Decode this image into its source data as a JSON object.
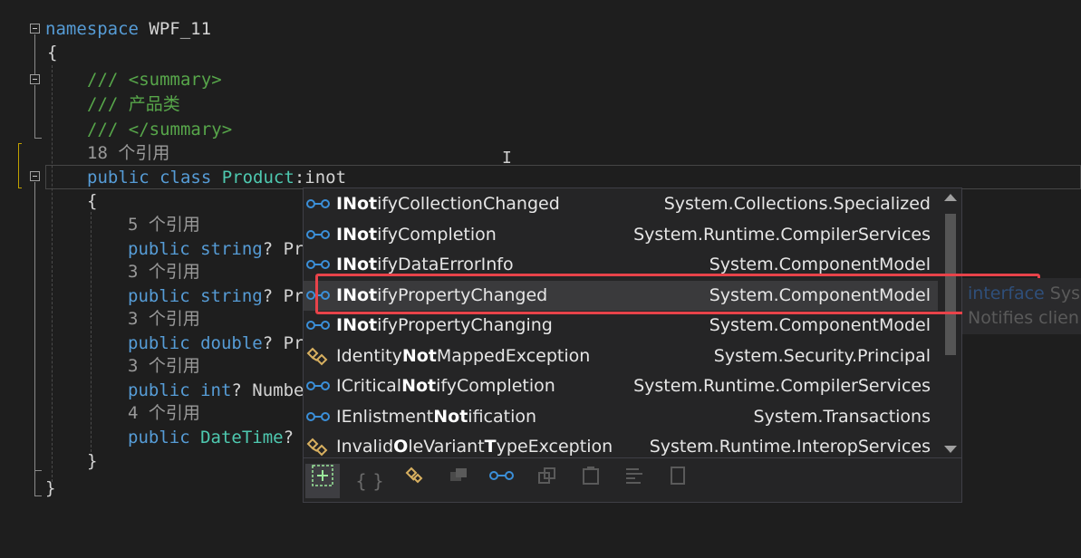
{
  "editor": {
    "lines": {
      "l1_kw": "namespace",
      "l1_name": " WPF_11",
      "l2": "{",
      "l3": "/// <summary>",
      "l4": "/// 产品类",
      "l5": "/// </summary>",
      "l6": "18 个引用",
      "l7_kw": "public class",
      "l7_type": "Product",
      "l7_rest": ":inot",
      "l8": "{",
      "p1_ref": "5 个引用",
      "p1_kw": "public string",
      "p1_rest": "? Pr",
      "p2_ref": "3 个引用",
      "p2_kw": "public string",
      "p2_rest": "? Pr",
      "p3_ref": "3 个引用",
      "p3_kw": "public double",
      "p3_rest": "? Pr",
      "p4_ref": "3 个引用",
      "p4_kw": "public int",
      "p4_rest": "? Numbe",
      "p5_ref": "4 个引用",
      "p5_kw": "public",
      "p5_type": "DateTime",
      "p5_rest": "?",
      "close_inner": "}",
      "close_outer": "}"
    }
  },
  "completion": {
    "items": [
      {
        "pre": "",
        "bold": "INot",
        "post": "ifyCollectionChanged",
        "ns": "System.Collections.Specialized",
        "icon": "interface-icon"
      },
      {
        "pre": "",
        "bold": "INot",
        "post": "ifyCompletion",
        "ns": "System.Runtime.CompilerServices",
        "icon": "interface-icon"
      },
      {
        "pre": "",
        "bold": "INot",
        "post": "ifyDataErrorInfo",
        "ns": "System.ComponentModel",
        "icon": "interface-icon"
      },
      {
        "pre": "",
        "bold": "INot",
        "post": "ifyPropertyChanged",
        "ns": "System.ComponentModel",
        "icon": "interface-icon"
      },
      {
        "pre": "",
        "bold": "INot",
        "post": "ifyPropertyChanging",
        "ns": "System.ComponentModel",
        "icon": "interface-icon"
      },
      {
        "pre": "Identity",
        "bold": "Not",
        "post": "MappedException",
        "ns": "System.Security.Principal",
        "icon": "class-icon"
      },
      {
        "pre": "ICritical",
        "bold": "Not",
        "post": "ifyCompletion",
        "ns": "System.Runtime.CompilerServices",
        "icon": "interface-icon"
      },
      {
        "pre": "IEnlistment",
        "bold": "Not",
        "post": "ification",
        "ns": "System.Transactions",
        "icon": "interface-icon"
      },
      {
        "pre": "Invalid",
        "bold": "O",
        "post": "leVariant",
        "bold2": "T",
        "post2": "ypeException",
        "ns": "System.Runtime.InteropServices",
        "icon": "class-icon"
      }
    ],
    "selected_index": 3,
    "toolbar": [
      "expand-icon",
      "namespace-icon",
      "class-icon",
      "struct-icon",
      "interface-icon",
      "enum-icon",
      "delegate-icon",
      "member-icon",
      "snippet-icon"
    ]
  },
  "tooltip": {
    "kw": "interface",
    "name": " Sys",
    "desc": "Notifies clien"
  },
  "colors": {
    "keyword": "#569cd6",
    "type": "#4ec9b0",
    "comment": "#57a64a",
    "highlight_box": "#e8434a"
  }
}
